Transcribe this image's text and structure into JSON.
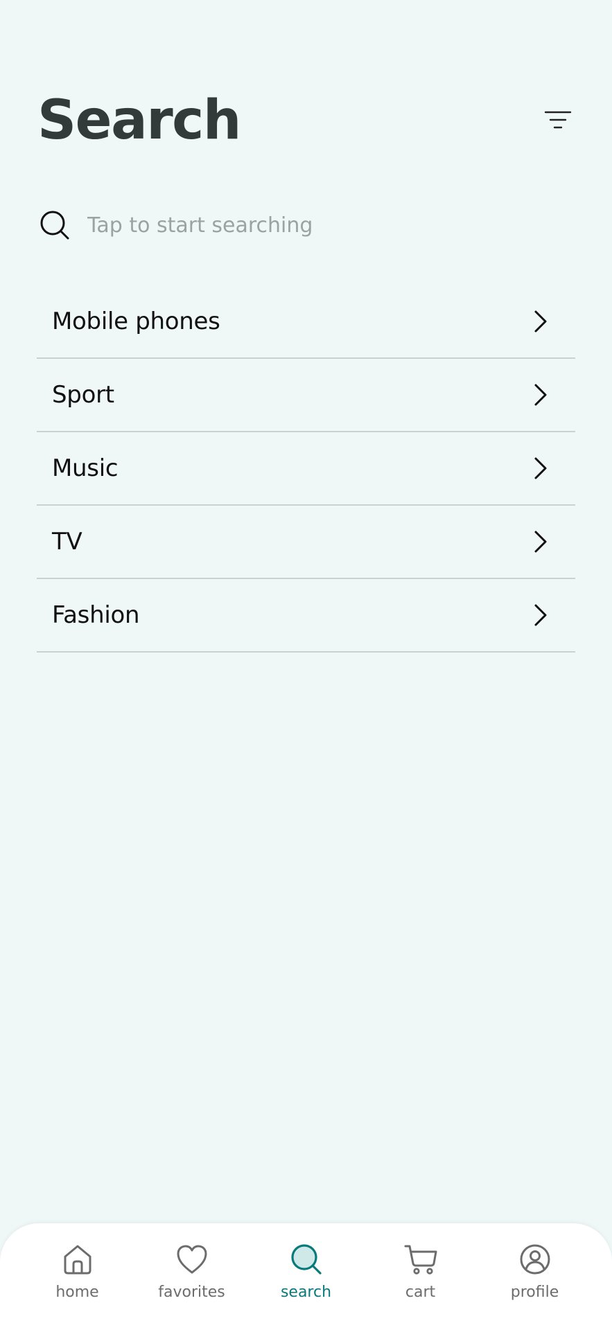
{
  "header": {
    "title": "Search",
    "filter_icon": "filter-icon"
  },
  "search": {
    "placeholder": "Tap to start searching",
    "value": "",
    "icon": "search-icon"
  },
  "categories": [
    {
      "label": "Mobile phones"
    },
    {
      "label": "Sport"
    },
    {
      "label": "Music"
    },
    {
      "label": "TV"
    },
    {
      "label": "Fashion"
    }
  ],
  "bottom_nav": {
    "active": "search",
    "items": [
      {
        "id": "home",
        "label": "home",
        "icon": "home-icon"
      },
      {
        "id": "favorites",
        "label": "favorites",
        "icon": "heart-icon"
      },
      {
        "id": "search",
        "label": "search",
        "icon": "search-icon"
      },
      {
        "id": "cart",
        "label": "cart",
        "icon": "cart-icon"
      },
      {
        "id": "profile",
        "label": "profile",
        "icon": "profile-icon"
      }
    ]
  },
  "colors": {
    "background": "#eff8f7",
    "accent": "#087a7c",
    "accent_fill": "#cfe9e8",
    "title": "#333a3a",
    "divider": "#c9d2d2",
    "nav_inactive": "#6c6c6c"
  }
}
